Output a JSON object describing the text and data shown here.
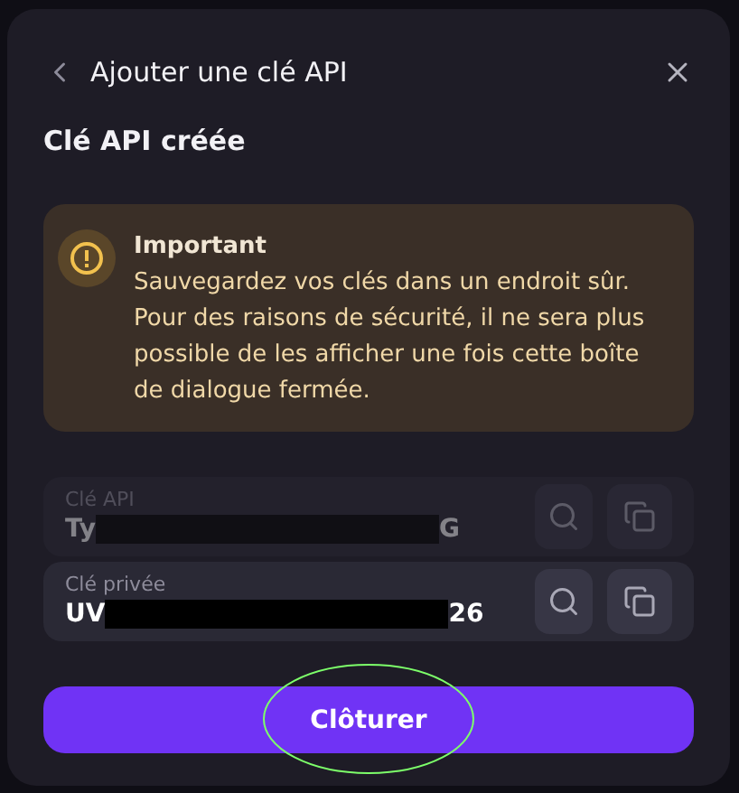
{
  "dialog": {
    "title": "Ajouter une clé API",
    "subtitle": "Clé API créée",
    "alert": {
      "title": "Important",
      "text": "Sauvegardez vos clés dans un endroit sûr. Pour des raisons de sécurité, il ne sera plus possible de les afficher une fois cette boîte de dialogue fermée."
    },
    "fields": [
      {
        "label": "Clé API",
        "value_start": "Ty",
        "value_end": "G",
        "redacted": true,
        "faded": true
      },
      {
        "label": "Clé privée",
        "value_start": "UV",
        "value_end": "26",
        "redacted": true,
        "faded": false
      }
    ],
    "button": "Clôturer",
    "highlight": true
  }
}
